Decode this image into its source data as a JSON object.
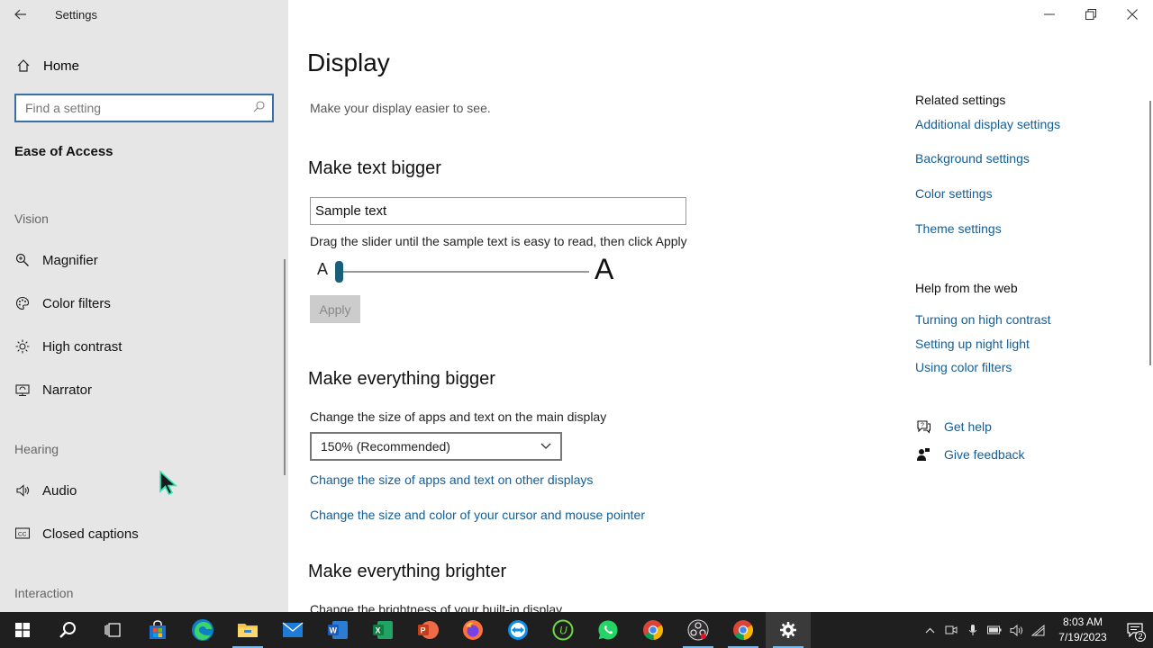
{
  "window": {
    "title": "Settings"
  },
  "sidebar": {
    "home_label": "Home",
    "search_placeholder": "Find a setting",
    "section_title": "Ease of Access",
    "groups": [
      {
        "label": "Vision",
        "items": [
          "Magnifier",
          "Color filters",
          "High contrast",
          "Narrator"
        ]
      },
      {
        "label": "Hearing",
        "items": [
          "Audio",
          "Closed captions"
        ]
      },
      {
        "label": "Interaction",
        "items": []
      }
    ]
  },
  "main": {
    "title": "Display",
    "subtitle": "Make your display easier to see.",
    "text_bigger": {
      "heading": "Make text bigger",
      "sample": "Sample text",
      "hint": "Drag the slider until the sample text is easy to read, then click Apply",
      "slider_min_label": "A",
      "slider_max_label": "A",
      "slider_value": 0,
      "apply_label": "Apply"
    },
    "everything_bigger": {
      "heading": "Make everything bigger",
      "label": "Change the size of apps and text on the main display",
      "dropdown_value": "150% (Recommended)",
      "link_other_displays": "Change the size of apps and text on other displays",
      "link_cursor": "Change the size and color of your cursor and mouse pointer"
    },
    "everything_brighter": {
      "heading": "Make everything brighter",
      "label": "Change the brightness of your built-in display"
    }
  },
  "related": {
    "heading": "Related settings",
    "links": [
      "Additional display settings",
      "Background settings",
      "Color settings",
      "Theme settings"
    ]
  },
  "help_web": {
    "heading": "Help from the web",
    "links": [
      "Turning on high contrast",
      "Setting up night light",
      "Using color filters"
    ]
  },
  "support": {
    "get_help": "Get help",
    "give_feedback": "Give feedback"
  },
  "taskbar": {
    "time": "8:03 AM",
    "date": "7/19/2023",
    "notification_count": "2",
    "apps": [
      "start",
      "search",
      "task-view",
      "store",
      "edge",
      "file-explorer",
      "mail",
      "word",
      "excel",
      "powerpoint",
      "firefox",
      "teamviewer",
      "upwork",
      "whatsapp",
      "chrome",
      "obs",
      "chrome-profile",
      "settings"
    ]
  },
  "colors": {
    "accent": "#135e96",
    "sidebar_bg": "#e6e6e6",
    "taskbar_bg": "#1f1f1f",
    "slider_thumb": "#1a5f7a"
  }
}
